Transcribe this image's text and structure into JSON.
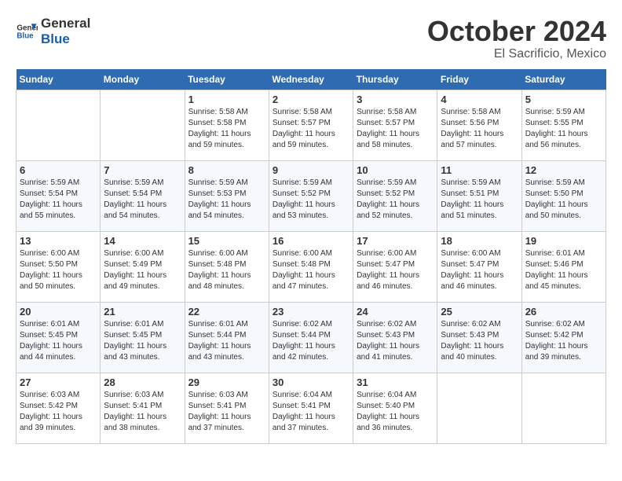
{
  "header": {
    "logo_line1": "General",
    "logo_line2": "Blue",
    "month_title": "October 2024",
    "subtitle": "El Sacrificio, Mexico"
  },
  "weekdays": [
    "Sunday",
    "Monday",
    "Tuesday",
    "Wednesday",
    "Thursday",
    "Friday",
    "Saturday"
  ],
  "weeks": [
    [
      {
        "day": "",
        "info": ""
      },
      {
        "day": "",
        "info": ""
      },
      {
        "day": "1",
        "info": "Sunrise: 5:58 AM\nSunset: 5:58 PM\nDaylight: 11 hours and 59 minutes."
      },
      {
        "day": "2",
        "info": "Sunrise: 5:58 AM\nSunset: 5:57 PM\nDaylight: 11 hours and 59 minutes."
      },
      {
        "day": "3",
        "info": "Sunrise: 5:58 AM\nSunset: 5:57 PM\nDaylight: 11 hours and 58 minutes."
      },
      {
        "day": "4",
        "info": "Sunrise: 5:58 AM\nSunset: 5:56 PM\nDaylight: 11 hours and 57 minutes."
      },
      {
        "day": "5",
        "info": "Sunrise: 5:59 AM\nSunset: 5:55 PM\nDaylight: 11 hours and 56 minutes."
      }
    ],
    [
      {
        "day": "6",
        "info": "Sunrise: 5:59 AM\nSunset: 5:54 PM\nDaylight: 11 hours and 55 minutes."
      },
      {
        "day": "7",
        "info": "Sunrise: 5:59 AM\nSunset: 5:54 PM\nDaylight: 11 hours and 54 minutes."
      },
      {
        "day": "8",
        "info": "Sunrise: 5:59 AM\nSunset: 5:53 PM\nDaylight: 11 hours and 54 minutes."
      },
      {
        "day": "9",
        "info": "Sunrise: 5:59 AM\nSunset: 5:52 PM\nDaylight: 11 hours and 53 minutes."
      },
      {
        "day": "10",
        "info": "Sunrise: 5:59 AM\nSunset: 5:52 PM\nDaylight: 11 hours and 52 minutes."
      },
      {
        "day": "11",
        "info": "Sunrise: 5:59 AM\nSunset: 5:51 PM\nDaylight: 11 hours and 51 minutes."
      },
      {
        "day": "12",
        "info": "Sunrise: 5:59 AM\nSunset: 5:50 PM\nDaylight: 11 hours and 50 minutes."
      }
    ],
    [
      {
        "day": "13",
        "info": "Sunrise: 6:00 AM\nSunset: 5:50 PM\nDaylight: 11 hours and 50 minutes."
      },
      {
        "day": "14",
        "info": "Sunrise: 6:00 AM\nSunset: 5:49 PM\nDaylight: 11 hours and 49 minutes."
      },
      {
        "day": "15",
        "info": "Sunrise: 6:00 AM\nSunset: 5:48 PM\nDaylight: 11 hours and 48 minutes."
      },
      {
        "day": "16",
        "info": "Sunrise: 6:00 AM\nSunset: 5:48 PM\nDaylight: 11 hours and 47 minutes."
      },
      {
        "day": "17",
        "info": "Sunrise: 6:00 AM\nSunset: 5:47 PM\nDaylight: 11 hours and 46 minutes."
      },
      {
        "day": "18",
        "info": "Sunrise: 6:00 AM\nSunset: 5:47 PM\nDaylight: 11 hours and 46 minutes."
      },
      {
        "day": "19",
        "info": "Sunrise: 6:01 AM\nSunset: 5:46 PM\nDaylight: 11 hours and 45 minutes."
      }
    ],
    [
      {
        "day": "20",
        "info": "Sunrise: 6:01 AM\nSunset: 5:45 PM\nDaylight: 11 hours and 44 minutes."
      },
      {
        "day": "21",
        "info": "Sunrise: 6:01 AM\nSunset: 5:45 PM\nDaylight: 11 hours and 43 minutes."
      },
      {
        "day": "22",
        "info": "Sunrise: 6:01 AM\nSunset: 5:44 PM\nDaylight: 11 hours and 43 minutes."
      },
      {
        "day": "23",
        "info": "Sunrise: 6:02 AM\nSunset: 5:44 PM\nDaylight: 11 hours and 42 minutes."
      },
      {
        "day": "24",
        "info": "Sunrise: 6:02 AM\nSunset: 5:43 PM\nDaylight: 11 hours and 41 minutes."
      },
      {
        "day": "25",
        "info": "Sunrise: 6:02 AM\nSunset: 5:43 PM\nDaylight: 11 hours and 40 minutes."
      },
      {
        "day": "26",
        "info": "Sunrise: 6:02 AM\nSunset: 5:42 PM\nDaylight: 11 hours and 39 minutes."
      }
    ],
    [
      {
        "day": "27",
        "info": "Sunrise: 6:03 AM\nSunset: 5:42 PM\nDaylight: 11 hours and 39 minutes."
      },
      {
        "day": "28",
        "info": "Sunrise: 6:03 AM\nSunset: 5:41 PM\nDaylight: 11 hours and 38 minutes."
      },
      {
        "day": "29",
        "info": "Sunrise: 6:03 AM\nSunset: 5:41 PM\nDaylight: 11 hours and 37 minutes."
      },
      {
        "day": "30",
        "info": "Sunrise: 6:04 AM\nSunset: 5:41 PM\nDaylight: 11 hours and 37 minutes."
      },
      {
        "day": "31",
        "info": "Sunrise: 6:04 AM\nSunset: 5:40 PM\nDaylight: 11 hours and 36 minutes."
      },
      {
        "day": "",
        "info": ""
      },
      {
        "day": "",
        "info": ""
      }
    ]
  ]
}
